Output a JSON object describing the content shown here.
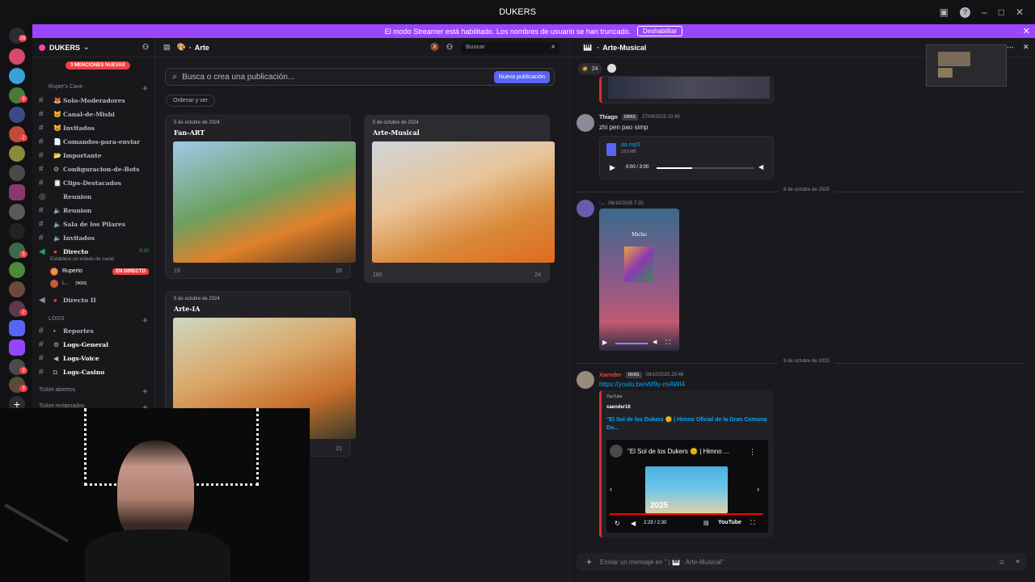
{
  "window": {
    "title": "DUKERS",
    "help": "?",
    "min": "–",
    "max": "□",
    "close": "✕"
  },
  "banner": {
    "text": "El modo Streamer está habilitado. Los nombres de usuario se han truncado.",
    "button": "Deshabilitar",
    "close": "✕"
  },
  "guilds": {
    "badges": [
      "29",
      "9",
      "2",
      "5",
      "2",
      "9",
      "3",
      "7"
    ]
  },
  "server": {
    "name": "DUKERS",
    "mention_pill": "3 MENCIONES NUEVAS"
  },
  "categories": {
    "ruper": "Ruper's Cave",
    "logs": "LOGS",
    "ticket_open": "Ticket abiertos",
    "ticket_claimed": "Ticket reclamados"
  },
  "channels": [
    {
      "emoji": "🦊",
      "name": "Solo-Moderadores"
    },
    {
      "emoji": "🐱",
      "name": "Canal-de-Mishi"
    },
    {
      "emoji": "😺",
      "name": "Invitados"
    },
    {
      "emoji": "📄",
      "name": "Comandos-para-enviar"
    },
    {
      "emoji": "📂",
      "name": "Importante"
    },
    {
      "emoji": "⚙",
      "name": "Configuracion-de-Bots"
    },
    {
      "emoji": "📋",
      "name": "Clips-Destacados"
    },
    {
      "emoji": "",
      "name": "Reunion"
    },
    {
      "emoji": "🔈",
      "name": "Reunion"
    },
    {
      "emoji": "🔈",
      "name": "Sala de los Pilares"
    },
    {
      "emoji": "🔈",
      "name": "Invitados"
    }
  ],
  "directo": {
    "name": "Directo",
    "time": "9:30",
    "status_hint": "Establece un estado de canal",
    "user1": "Ruperto",
    "live": "EN DIRECTO",
    "user2": "L...",
    "user2_tag": "DKRS",
    "second": "Directo II"
  },
  "log_channels": [
    "Reportes",
    "Logs-General",
    "Logs-Voice",
    "Logs-Casino"
  ],
  "forum": {
    "channel": "Arte",
    "search_placeholder": "Buscar",
    "post_search": "Busca o crea una publicación...",
    "new_post": "Nueva publicación",
    "sort": "Ordenar y ver"
  },
  "posts": [
    {
      "date": "5 de octubre de 2024",
      "title": "Fan-ART",
      "comments": "19",
      "reactions": "26"
    },
    {
      "date": "5 de octubre de 2024",
      "title": "Arte-Musical",
      "comments": "160",
      "reactions": "24"
    },
    {
      "date": "5 de octubre de 2024",
      "title": "Arte-IA",
      "comments": "",
      "reactions": "21"
    }
  ],
  "chat": {
    "channel": "Arte-Musical",
    "top_reaction": "24",
    "m1": {
      "user": "Thiago",
      "tag": "DKRS",
      "time": "27/09/2025 20:49",
      "text": "zhi pen pao simp",
      "file": "aa.mp3",
      "size": "3.83 MB",
      "audio_time": "0:00 / 3:00"
    },
    "div1": "6 de octubre de 2025",
    "m2": {
      "time": "06/10/2025 7:20",
      "poster_title": "Miche"
    },
    "div2": "9 de octubre de 2025",
    "m3": {
      "user": "Xaender",
      "tag": "DKRS",
      "time": "09/10/2025 20:46",
      "link": "https://youtu.be/vM9y-miAWl4",
      "provider": "YouTube",
      "author": "xaender16",
      "title": "\"El Sol de los Dukers 🌞 | Himno Oficial de la Gran Comuna Du...",
      "video_title": "\"El Sol de los Dukers 🌞 | Himno ...",
      "year": "2025",
      "progress": "2:29 / 2:30",
      "brand": "YouTube"
    },
    "composer": "Enviar un mensaje en \" | 🎹 · Arte-Musical\""
  },
  "colors": {
    "accent": "#5865f2",
    "streamer": "#9b45ff",
    "live": "#f23f43"
  }
}
